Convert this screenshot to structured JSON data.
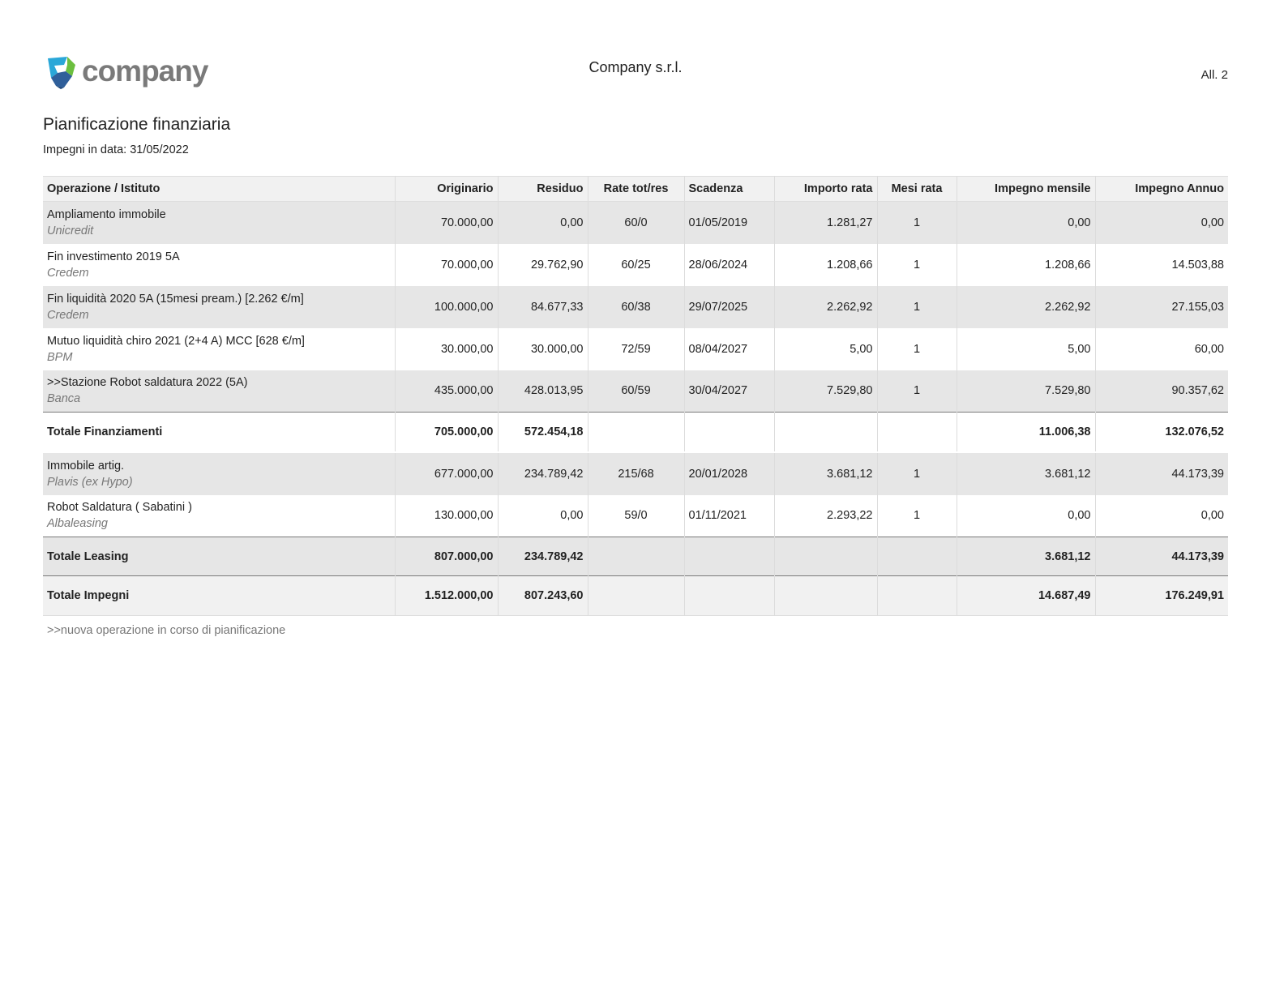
{
  "header": {
    "logo_text": "company",
    "company_name": "Company s.r.l.",
    "attachment": "All. 2"
  },
  "title": "Pianificazione finanziaria",
  "subtitle": "Impegni in data: 31/05/2022",
  "columns": {
    "operazione": "Operazione / Istituto",
    "originario": "Originario",
    "residuo": "Residuo",
    "rate": "Rate tot/res",
    "scadenza": "Scadenza",
    "importo_rata": "Importo rata",
    "mesi_rata": "Mesi rata",
    "impegno_mensile": "Impegno mensile",
    "impegno_annuo": "Impegno Annuo"
  },
  "finanziamenti": [
    {
      "name": "Ampliamento immobile",
      "bank": "Unicredit",
      "originario": "70.000,00",
      "residuo": "0,00",
      "rate": "60/0",
      "scadenza": "01/05/2019",
      "importo_rata": "1.281,27",
      "mesi_rata": "1",
      "impegno_mensile": "0,00",
      "impegno_annuo": "0,00"
    },
    {
      "name": "Fin investimento 2019 5A",
      "bank": "Credem",
      "originario": "70.000,00",
      "residuo": "29.762,90",
      "rate": "60/25",
      "scadenza": "28/06/2024",
      "importo_rata": "1.208,66",
      "mesi_rata": "1",
      "impegno_mensile": "1.208,66",
      "impegno_annuo": "14.503,88"
    },
    {
      "name": "Fin liquidità 2020 5A (15mesi pream.) [2.262 €/m]",
      "bank": "Credem",
      "originario": "100.000,00",
      "residuo": "84.677,33",
      "rate": "60/38",
      "scadenza": "29/07/2025",
      "importo_rata": "2.262,92",
      "mesi_rata": "1",
      "impegno_mensile": "2.262,92",
      "impegno_annuo": "27.155,03"
    },
    {
      "name": "Mutuo liquidità chiro 2021 (2+4 A) MCC [628 €/m]",
      "bank": "BPM",
      "originario": "30.000,00",
      "residuo": "30.000,00",
      "rate": "72/59",
      "scadenza": "08/04/2027",
      "importo_rata": "5,00",
      "mesi_rata": "1",
      "impegno_mensile": "5,00",
      "impegno_annuo": "60,00"
    },
    {
      "name": ">>Stazione Robot saldatura 2022 (5A)",
      "bank": "Banca",
      "originario": "435.000,00",
      "residuo": "428.013,95",
      "rate": "60/59",
      "scadenza": "30/04/2027",
      "importo_rata": "7.529,80",
      "mesi_rata": "1",
      "impegno_mensile": "7.529,80",
      "impegno_annuo": "90.357,62"
    }
  ],
  "totale_finanziamenti": {
    "label": "Totale Finanziamenti",
    "originario": "705.000,00",
    "residuo": "572.454,18",
    "impegno_mensile": "11.006,38",
    "impegno_annuo": "132.076,52"
  },
  "leasing": [
    {
      "name": "Immobile artig.",
      "bank": "Plavis (ex Hypo)",
      "originario": "677.000,00",
      "residuo": "234.789,42",
      "rate": "215/68",
      "scadenza": "20/01/2028",
      "importo_rata": "3.681,12",
      "mesi_rata": "1",
      "impegno_mensile": "3.681,12",
      "impegno_annuo": "44.173,39"
    },
    {
      "name": "Robot Saldatura ( Sabatini )",
      "bank": "Albaleasing",
      "originario": "130.000,00",
      "residuo": "0,00",
      "rate": "59/0",
      "scadenza": "01/11/2021",
      "importo_rata": "2.293,22",
      "mesi_rata": "1",
      "impegno_mensile": "0,00",
      "impegno_annuo": "0,00"
    }
  ],
  "totale_leasing": {
    "label": "Totale Leasing",
    "originario": "807.000,00",
    "residuo": "234.789,42",
    "impegno_mensile": "3.681,12",
    "impegno_annuo": "44.173,39"
  },
  "totale_impegni": {
    "label": "Totale Impegni",
    "originario": "1.512.000,00",
    "residuo": "807.243,60",
    "impegno_mensile": "14.687,49",
    "impegno_annuo": "176.249,91"
  },
  "footnote": ">>nuova operazione in corso di pianificazione"
}
